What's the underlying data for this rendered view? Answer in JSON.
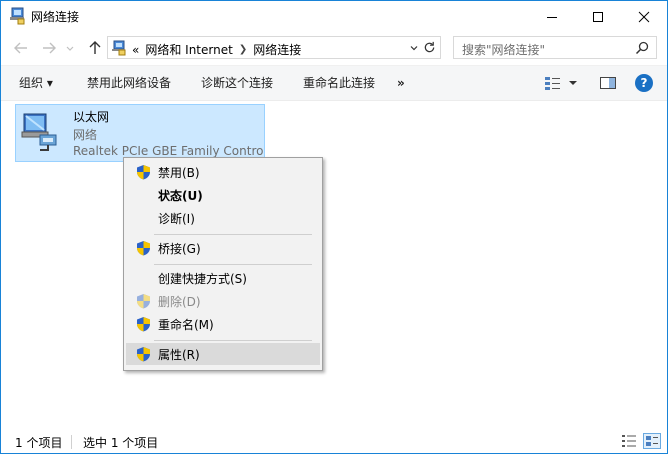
{
  "window": {
    "title": "网络连接",
    "minimize_icon": "minimize-icon",
    "maximize_icon": "maximize-icon",
    "close_icon": "close-icon"
  },
  "address": {
    "overflow": "«",
    "crumbs": [
      "网络和 Internet",
      "网络连接"
    ],
    "search_placeholder": "搜索\"网络连接\""
  },
  "toolbar": {
    "organize": "组织 ▾",
    "disable": "禁用此网络设备",
    "diagnose": "诊断这个连接",
    "rename": "重命名此连接",
    "more": "»",
    "help": "?"
  },
  "item": {
    "name": "以太网",
    "type": "网络",
    "device": "Realtek PCIe GBE Family Controller"
  },
  "context_menu": {
    "items": [
      {
        "label": "禁用(B)",
        "shield": true
      },
      {
        "label": "状态(U)",
        "shield": false,
        "bold": true
      },
      {
        "label": "诊断(I)",
        "shield": false
      },
      {
        "label": "桥接(G)",
        "shield": true
      },
      {
        "label": "创建快捷方式(S)",
        "shield": false
      },
      {
        "label": "删除(D)",
        "shield": true,
        "disabled": true
      },
      {
        "label": "重命名(M)",
        "shield": true
      },
      {
        "label": "属性(R)",
        "shield": true,
        "highlighted": true
      }
    ]
  },
  "status": {
    "count": "1 个项目",
    "selected": "选中 1 个项目"
  },
  "colors": {
    "selection_bg": "#cce8ff",
    "selection_border": "#99d1ff",
    "window_border": "#1883d7",
    "shield_blue": "#2b62c8",
    "shield_yellow": "#f5c400"
  }
}
